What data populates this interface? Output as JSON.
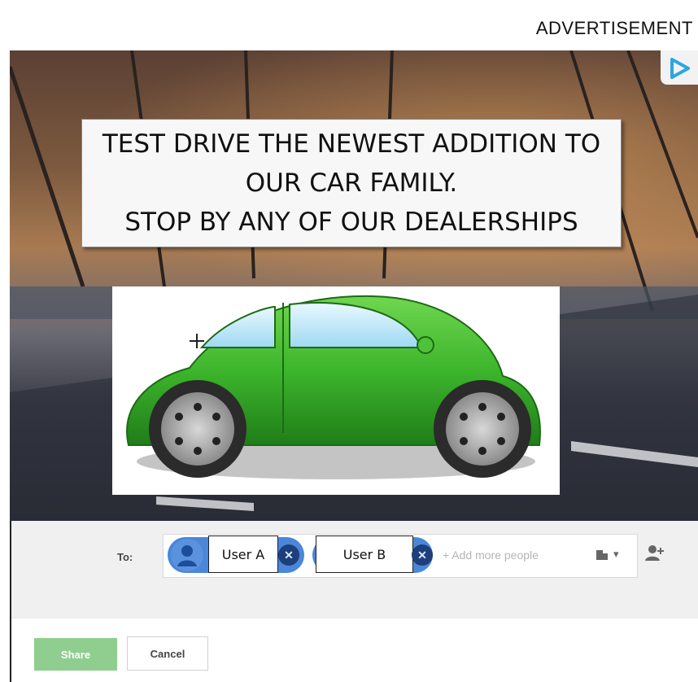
{
  "ad": {
    "label": "ADVERTISEMENT",
    "headline_lines": [
      "TEST DRIVE THE NEWEST ADDITION TO",
      "OUR CAR FAMILY.",
      "STOP BY ANY OF OUR DEALERSHIPS"
    ],
    "adchoices_icon": "adchoices-icon",
    "car_color": "#3db52c"
  },
  "share": {
    "to_label": "To:",
    "recipients": [
      {
        "name": "User A"
      },
      {
        "name": "User B"
      }
    ],
    "add_placeholder": "+ Add more people",
    "share_label": "Share",
    "cancel_label": "Cancel",
    "chip_color": "#4a86d9",
    "share_color": "#8fce8f"
  }
}
